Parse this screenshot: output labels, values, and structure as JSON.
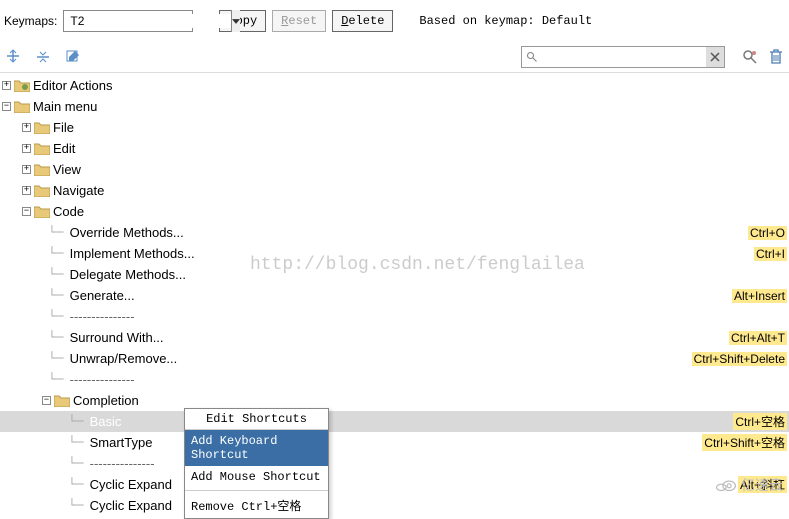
{
  "top": {
    "keymaps_label": "Keymaps:",
    "keymap_value": "T2",
    "copy_u": "C",
    "copy_rest": "opy",
    "reset_u": "R",
    "reset_rest": "eset",
    "delete_u": "D",
    "delete_rest": "elete",
    "based": "Based on keymap: Default"
  },
  "search": {
    "placeholder": ""
  },
  "tree": {
    "editor_actions": "Editor Actions",
    "main_menu": "Main menu",
    "file": "File",
    "edit": "Edit",
    "view": "View",
    "navigate": "Navigate",
    "code": "Code",
    "override": "Override Methods...",
    "implement": "Implement Methods...",
    "delegate": "Delegate Methods...",
    "generate": "Generate...",
    "sep": "---------------",
    "surround": "Surround With...",
    "unwrap": "Unwrap/Remove...",
    "completion": "Completion",
    "basic": "Basic",
    "smarttype": "SmartType",
    "cyclic1": "Cyclic Expand",
    "cyclic2": "Cyclic Expand"
  },
  "sc": {
    "override": "Ctrl+O",
    "implement": "Ctrl+I",
    "generate": "Alt+Insert",
    "surround": "Ctrl+Alt+T",
    "unwrap": "Ctrl+Shift+Delete",
    "basic": "Ctrl+空格",
    "smarttype": "Ctrl+Shift+空格",
    "cyclic1": "Alt+斜杠"
  },
  "ctx": {
    "title": "Edit Shortcuts",
    "add_kb": "Add Keyboard Shortcut",
    "add_mouse": "Add Mouse Shortcut",
    "remove": "Remove Ctrl+空格"
  },
  "watermark": "http://blog.csdn.net/fenglailea",
  "logo": "亿速云"
}
